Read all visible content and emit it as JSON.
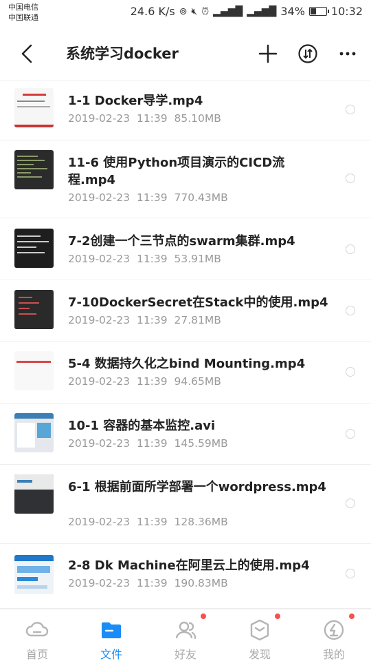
{
  "status_bar": {
    "carrier_1": "中国电信",
    "carrier_2": "中国联通",
    "speed": "24.6 K/s",
    "battery": "34%",
    "battery_level": 0.34,
    "time": "10:32",
    "icons": [
      "hotspot-icon",
      "mute-icon",
      "alarm-icon",
      "signal-4g-icon",
      "signal-3g-icon",
      "battery-icon"
    ]
  },
  "header": {
    "title": "系统学习docker",
    "actions": [
      "back-icon",
      "add-icon",
      "sort-icon",
      "more-icon"
    ]
  },
  "files": [
    {
      "name": "1-1 Docker导学.mp4",
      "date": "2019-02-23",
      "time": "11:39",
      "size": "85.10MB"
    },
    {
      "name": "11-6 使用Python项目演示的CICD流程.mp4",
      "date": "2019-02-23",
      "time": "11:39",
      "size": "770.43MB"
    },
    {
      "name": "7-2创建一个三节点的swarm集群.mp4",
      "date": "2019-02-23",
      "time": "11:39",
      "size": "53.91MB"
    },
    {
      "name": "7-10DockerSecret在Stack中的使用.mp4",
      "date": "2019-02-23",
      "time": "11:39",
      "size": "27.81MB"
    },
    {
      "name": "5-4 数据持久化之bind Mounting.mp4",
      "date": "2019-02-23",
      "time": "11:39",
      "size": "94.65MB"
    },
    {
      "name": "10-1 容器的基本监控.avi",
      "date": "2019-02-23",
      "time": "11:39",
      "size": "145.59MB"
    },
    {
      "name": "6-1 根据前面所学部署一个wordpress.mp4",
      "date": "2019-02-23",
      "time": "11:39",
      "size": "128.36MB"
    },
    {
      "name": "2-8 Dk Machine在阿里云上的使用.mp4",
      "date": "2019-02-23",
      "time": "11:39",
      "size": "190.83MB"
    }
  ],
  "bottom_nav": [
    {
      "label": "首页",
      "icon": "home-cloud-icon",
      "active": false,
      "badge": false
    },
    {
      "label": "文件",
      "icon": "folder-icon",
      "active": true,
      "badge": false
    },
    {
      "label": "好友",
      "icon": "friends-icon",
      "active": false,
      "badge": true
    },
    {
      "label": "发现",
      "icon": "discover-icon",
      "active": false,
      "badge": true
    },
    {
      "label": "我的",
      "icon": "profile-icon",
      "active": false,
      "badge": true
    }
  ],
  "colors": {
    "accent": "#1a8cf5",
    "badge": "#f4524d",
    "meta_text": "#9a9a9a"
  }
}
